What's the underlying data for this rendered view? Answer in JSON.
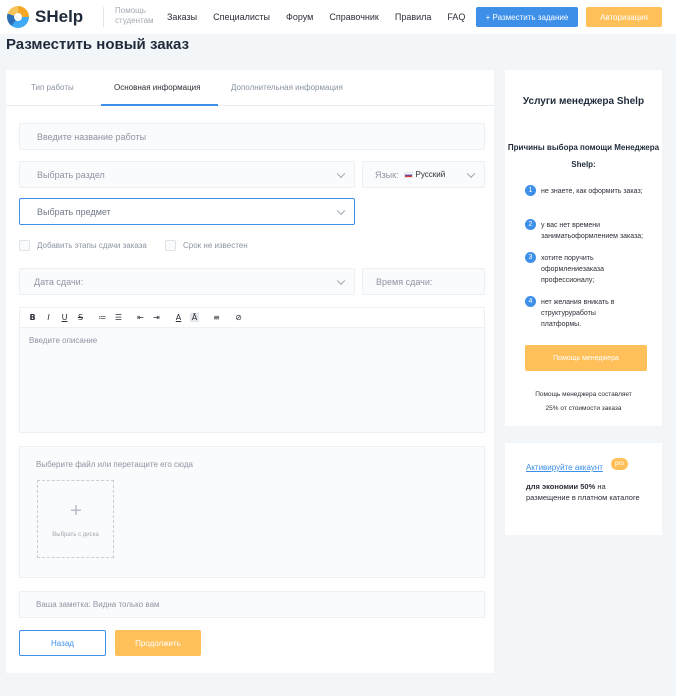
{
  "header": {
    "logo": "SHelp",
    "logo_sub": "Помощь студентам",
    "nav": [
      "Заказы",
      "Специалисты",
      "Форум",
      "Справочник",
      "Правила",
      "FAQ"
    ],
    "post_task_button": "+ Разместить задание",
    "auth_button": "Авторизация"
  },
  "page_title": "Разместить новый заказ",
  "tabs": [
    "Тип работы",
    "Основная информация",
    "Дополнительная информация"
  ],
  "form": {
    "title_placeholder": "Введите название работы",
    "section_placeholder": "Выбрать раздел",
    "language_label": "Язык:",
    "language_value": "Русский",
    "subject_placeholder": "Выбрать предмет",
    "add_stages_label": "Добавить этапы сдачи заказа",
    "deadline_unknown_label": "Срок не известен",
    "due_date_placeholder": "Дата сдачи:",
    "due_time_placeholder": "Время сдачи:",
    "toolbar": [
      "B",
      "I",
      "U",
      "S",
      "≔",
      "☰",
      "⇤",
      "⇥",
      "A",
      "Ā",
      "≡",
      "⊘"
    ],
    "description_placeholder": "Введите описание",
    "upload_label": "Выберите файл или перетащите его сюда",
    "upload_plus": "+",
    "upload_button": "Выбрать с диска",
    "note_placeholder": "Ваша заметка: Видна только вам",
    "back_button": "Назад",
    "next_button": "Продолжить"
  },
  "manager_panel": {
    "title": "Услуги менеджера Shelp",
    "subtitle": "Причины выбора помощи Менеджера Shelp:",
    "reasons": [
      {
        "num": "1",
        "text": "не знаете, как оформить заказ;"
      },
      {
        "num": "2",
        "text": "у вас нет времени заниматьоформлением заказа;"
      },
      {
        "num": "3",
        "text": "хотите поручить оформлениезаказа профессионалу;"
      },
      {
        "num": "4",
        "text": "нет желания вникать в структуруработы платформы."
      }
    ],
    "button": "Помощь менеджера",
    "note": "Помощь менеджера составляет 25% от стоимости заказа"
  },
  "promo_panel": {
    "activate_link": "Активируйте аккаунт",
    "badge": "pro",
    "text_bold": "для экономии 50%",
    "text_rest": " на размещение в платном каталоге"
  }
}
